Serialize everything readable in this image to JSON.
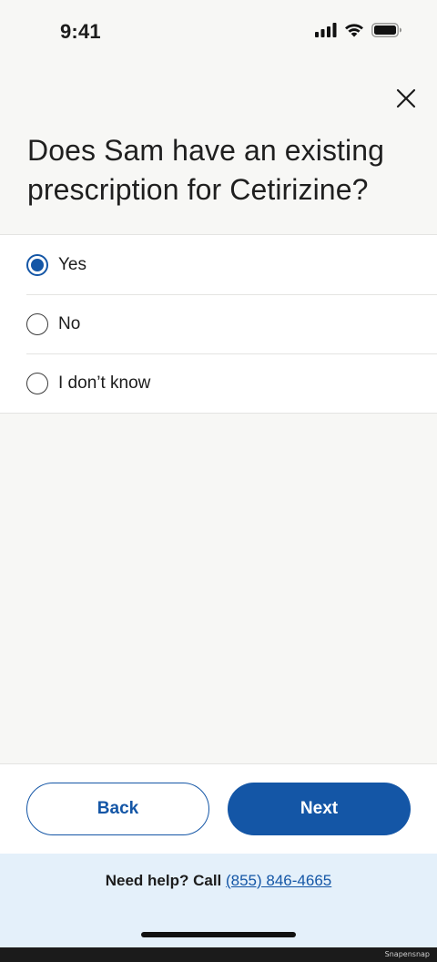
{
  "status_bar": {
    "time": "9:41",
    "icons": [
      "signal-icon",
      "wifi-icon",
      "battery-icon"
    ]
  },
  "header": {
    "close_icon": "close-icon"
  },
  "question": {
    "text": "Does Sam have an existing prescription for Cetirizine?"
  },
  "options": [
    {
      "label": "Yes",
      "selected": true
    },
    {
      "label": "No",
      "selected": false
    },
    {
      "label": "I don’t know",
      "selected": false
    }
  ],
  "actions": {
    "back_label": "Back",
    "next_label": "Next"
  },
  "help": {
    "prefix": "Need help? Call ",
    "phone": "(855) 846-4665"
  },
  "credit": {
    "text": "Snapensnap"
  },
  "colors": {
    "accent": "#1456a6",
    "background": "#f7f7f5",
    "help_background": "#e4f0fa"
  }
}
